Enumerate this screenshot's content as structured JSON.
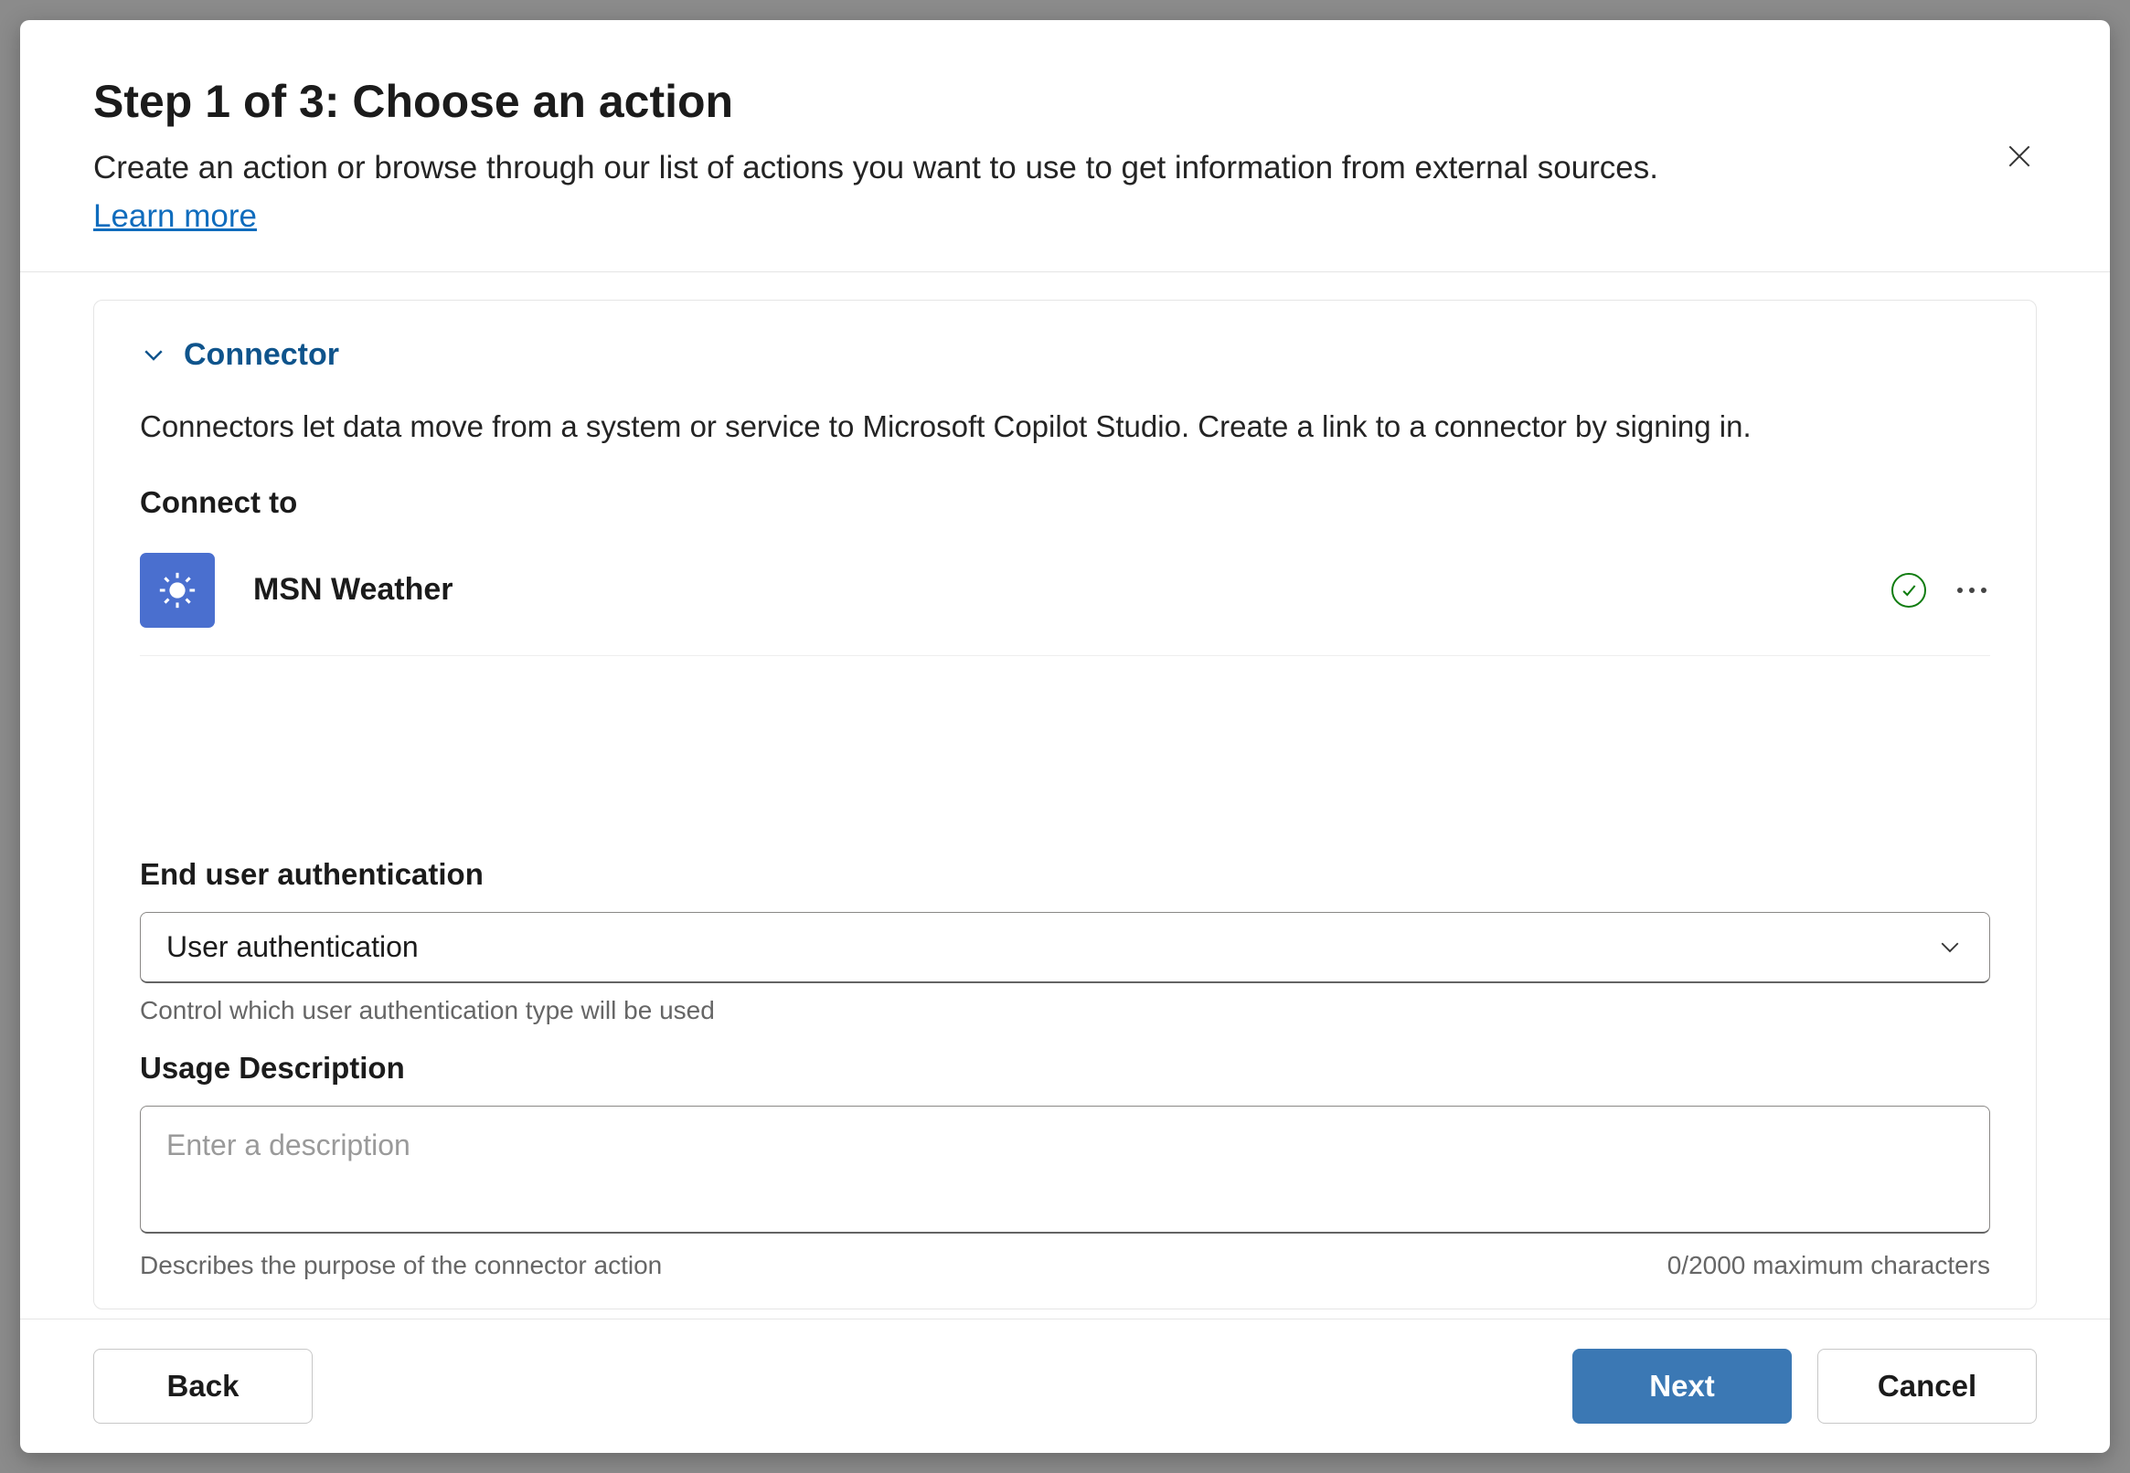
{
  "header": {
    "title": "Step 1 of 3: Choose an action",
    "subtitle": "Create an action or browse through our list of actions you want to use to get information from external sources.",
    "learn_more": "Learn more"
  },
  "connector": {
    "section_title": "Connector",
    "section_desc": "Connectors let data move from a system or service to Microsoft Copilot Studio. Create a link to a connector by signing in.",
    "connect_to_label": "Connect to",
    "selected": {
      "name": "MSN Weather"
    }
  },
  "auth": {
    "label": "End user authentication",
    "value": "User authentication",
    "help": "Control which user authentication type will be used"
  },
  "usage": {
    "label": "Usage Description",
    "placeholder": "Enter a description",
    "help": "Describes the purpose of the connector action",
    "counter": "0/2000 maximum characters"
  },
  "footer": {
    "back": "Back",
    "next": "Next",
    "cancel": "Cancel"
  }
}
